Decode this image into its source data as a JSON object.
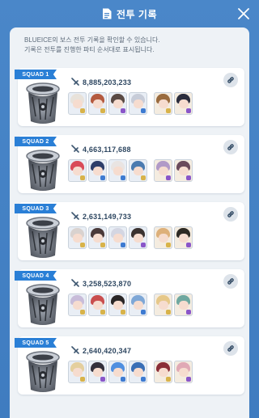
{
  "header": {
    "title": "전투 기록"
  },
  "description": {
    "line1": "BLUEICE의 보스 전투 기록을 확인할 수 있습니다.",
    "line2": "기록은 전투를 진행한 파티 순서대로 표시됩니다."
  },
  "squads": [
    {
      "label": "SQUAD 1",
      "score": "8,885,203,233",
      "units": [
        {
          "hair": "#e8e2da",
          "badge": "#d8b34a"
        },
        {
          "hair": "#b45a3f",
          "badge": "#d8b34a"
        },
        {
          "hair": "#5a4a44",
          "badge": "#8a56c9"
        },
        {
          "hair": "#c7ccd8",
          "badge": "#3e7bd1"
        },
        {
          "hair": "#9a6b3e",
          "badge": "#d8b34a"
        },
        {
          "hair": "#2a2c3c",
          "badge": "#8a56c9"
        }
      ]
    },
    {
      "label": "SQUAD 2",
      "score": "4,663,117,688",
      "units": [
        {
          "hair": "#d94b58",
          "badge": "#d8b34a"
        },
        {
          "hair": "#2e3e6a",
          "badge": "#3e7bd1"
        },
        {
          "hair": "#e9e4e2",
          "badge": "#3e7bd1"
        },
        {
          "hair": "#4b7bb0",
          "badge": "#d8b34a"
        },
        {
          "hair": "#b19ac7",
          "badge": "#8a56c9"
        },
        {
          "hair": "#6a4a5b",
          "badge": "#8a56c9"
        }
      ]
    },
    {
      "label": "SQUAD 3",
      "score": "2,631,149,733",
      "units": [
        {
          "hair": "#d9d2cf",
          "badge": "#d8b34a"
        },
        {
          "hair": "#4a3a3a",
          "badge": "#d8b34a"
        },
        {
          "hair": "#d4d6e2",
          "badge": "#3e7bd1"
        },
        {
          "hair": "#3b3230",
          "badge": "#8a56c9"
        },
        {
          "hair": "#ddb07a",
          "badge": "#d8b34a"
        },
        {
          "hair": "#2e2a24",
          "badge": "#8a56c9"
        }
      ]
    },
    {
      "label": "SQUAD 4",
      "score": "3,258,523,870",
      "units": [
        {
          "hair": "#c8bcd9",
          "badge": "#d8b34a"
        },
        {
          "hair": "#c94e4e",
          "badge": "#d8b34a"
        },
        {
          "hair": "#2a2626",
          "badge": "#d8b34a"
        },
        {
          "hair": "#7ea7d6",
          "badge": "#3e7bd1"
        },
        {
          "hair": "#e6c889",
          "badge": "#d8b34a"
        },
        {
          "hair": "#6fa8a0",
          "badge": "#8a56c9"
        }
      ]
    },
    {
      "label": "SQUAD 5",
      "score": "2,640,420,347",
      "units": [
        {
          "hair": "#e4cf9e",
          "badge": "#d8b34a"
        },
        {
          "hair": "#33303c",
          "badge": "#8a56c9"
        },
        {
          "hair": "#4f8fe0",
          "badge": "#3e7bd1"
        },
        {
          "hair": "#3a6fb6",
          "badge": "#3e7bd1"
        },
        {
          "hair": "#8a2e38",
          "badge": "#d8b34a"
        },
        {
          "hair": "#e0a9b5",
          "badge": "#8a56c9"
        }
      ]
    }
  ]
}
